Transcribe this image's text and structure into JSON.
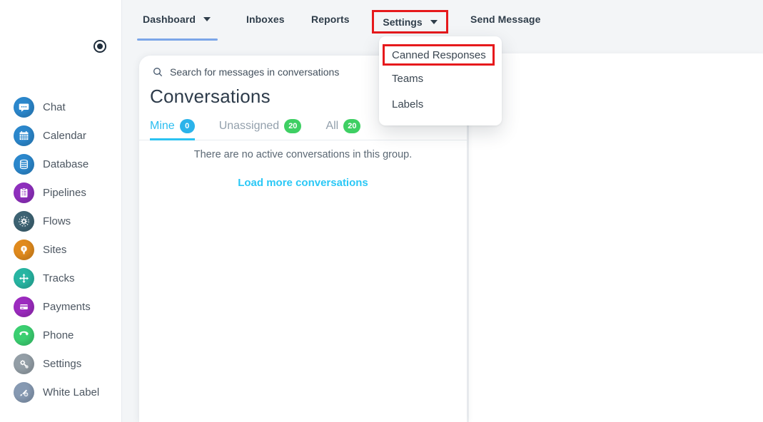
{
  "topnav": {
    "items": [
      {
        "label": "Dashboard"
      },
      {
        "label": "Inboxes"
      },
      {
        "label": "Reports"
      },
      {
        "label": "Settings"
      },
      {
        "label": "Send Message"
      }
    ]
  },
  "settings_menu": {
    "items": [
      {
        "label": "Canned Responses"
      },
      {
        "label": "Teams"
      },
      {
        "label": "Labels"
      }
    ]
  },
  "sidebar": {
    "items": [
      {
        "label": "Chat",
        "color": "#2b87cc",
        "icon": "chat-icon"
      },
      {
        "label": "Calendar",
        "color": "#2b87cc",
        "icon": "calendar-icon"
      },
      {
        "label": "Database",
        "color": "#2b87cc",
        "icon": "database-icon"
      },
      {
        "label": "Pipelines",
        "color": "#8e2fbd",
        "icon": "pipelines-icon"
      },
      {
        "label": "Flows",
        "color": "#3d6373",
        "icon": "flows-icon"
      },
      {
        "label": "Sites",
        "color": "#e08a1d",
        "icon": "sites-icon"
      },
      {
        "label": "Tracks",
        "color": "#27b5a2",
        "icon": "tracks-icon"
      },
      {
        "label": "Payments",
        "color": "#9c2bbf",
        "icon": "payments-icon"
      },
      {
        "label": "Phone",
        "color": "#3bcf71",
        "icon": "phone-icon"
      },
      {
        "label": "Settings",
        "color": "#939ea6",
        "icon": "settings-icon"
      },
      {
        "label": "White Label",
        "color": "#8699b2",
        "icon": "white-label-icon"
      }
    ]
  },
  "conversations": {
    "search_placeholder": "Search for messages in conversations",
    "title": "Conversations",
    "tabs": [
      {
        "label": "Mine",
        "count": "0",
        "badge_color": "#2bb3ea",
        "active": true
      },
      {
        "label": "Unassigned",
        "count": "20",
        "badge_color": "#3ecf63",
        "active": false
      },
      {
        "label": "All",
        "count": "20",
        "badge_color": "#3ecf63",
        "active": false
      }
    ],
    "empty_message": "There are no active conversations in this group.",
    "load_more_label": "Load more conversations"
  },
  "colors": {
    "accent_cyan": "#2bc2f1",
    "badge_green": "#3ecf63",
    "annotation_red": "#e6191c",
    "active_nav_underline": "#7ca6e8",
    "topbar_bg": "#f3f5f7"
  }
}
